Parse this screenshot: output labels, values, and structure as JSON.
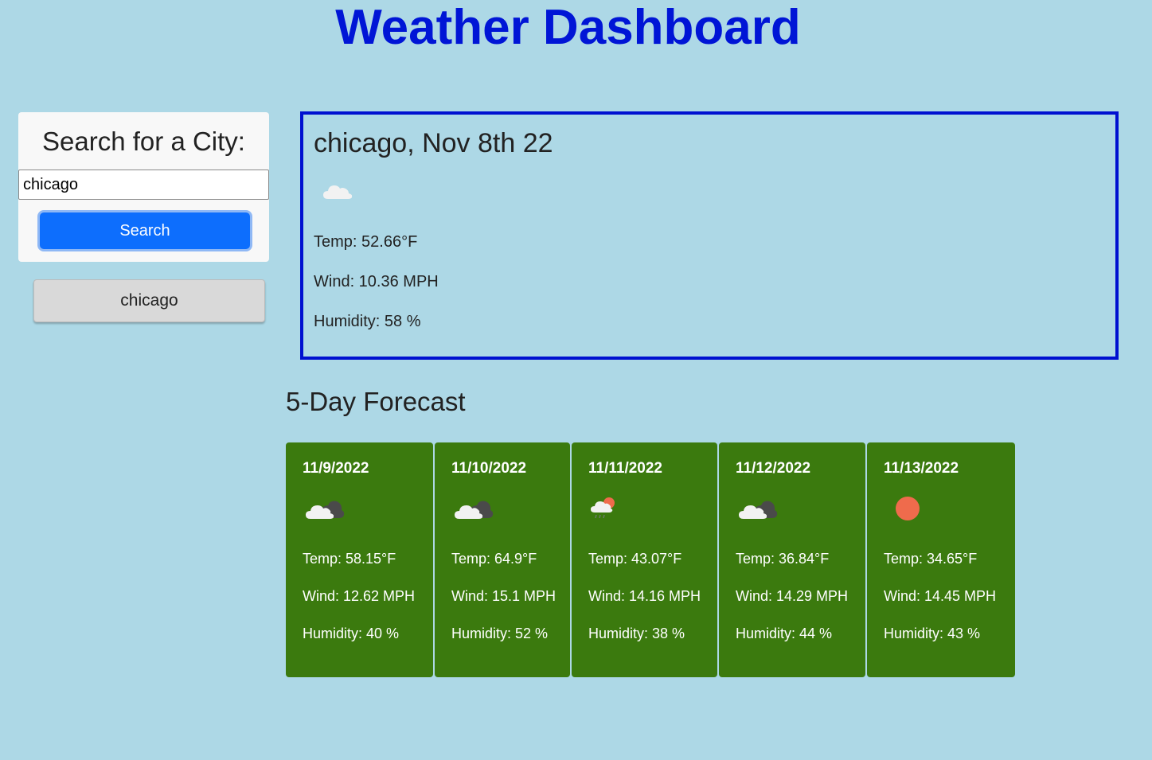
{
  "header": {
    "title": "Weather Dashboard"
  },
  "search": {
    "heading": "Search for a City:",
    "input_value": "chicago",
    "button_label": "Search"
  },
  "history": [
    "chicago"
  ],
  "current": {
    "title": "chicago, Nov 8th 22",
    "icon": "cloud-icon",
    "temp": "Temp: 52.66°F",
    "wind": "Wind: 10.36 MPH",
    "humidity": "Humidity: 58 %"
  },
  "forecast": {
    "heading": "5-Day Forecast",
    "days": [
      {
        "date": "11/9/2022",
        "icon": "broken-clouds-icon",
        "temp": "Temp: 58.15°F",
        "wind": "Wind: 12.62 MPH",
        "humidity": "Humidity: 40 %"
      },
      {
        "date": "11/10/2022",
        "icon": "broken-clouds-icon",
        "temp": "Temp: 64.9°F",
        "wind": "Wind: 15.1 MPH",
        "humidity": "Humidity: 52 %"
      },
      {
        "date": "11/11/2022",
        "icon": "rain-sun-icon",
        "temp": "Temp: 43.07°F",
        "wind": "Wind: 14.16 MPH",
        "humidity": "Humidity: 38 %"
      },
      {
        "date": "11/12/2022",
        "icon": "broken-clouds-icon",
        "temp": "Temp: 36.84°F",
        "wind": "Wind: 14.29 MPH",
        "humidity": "Humidity: 44 %"
      },
      {
        "date": "11/13/2022",
        "icon": "sun-icon",
        "temp": "Temp: 34.65°F",
        "wind": "Wind: 14.45 MPH",
        "humidity": "Humidity: 43 %"
      }
    ]
  },
  "colors": {
    "background": "#add8e6",
    "title": "#0015d6",
    "current_border": "#0010d0",
    "search_button": "#0d6efd",
    "forecast_card": "#3b7a0e",
    "sun": "#ef6b4c"
  }
}
